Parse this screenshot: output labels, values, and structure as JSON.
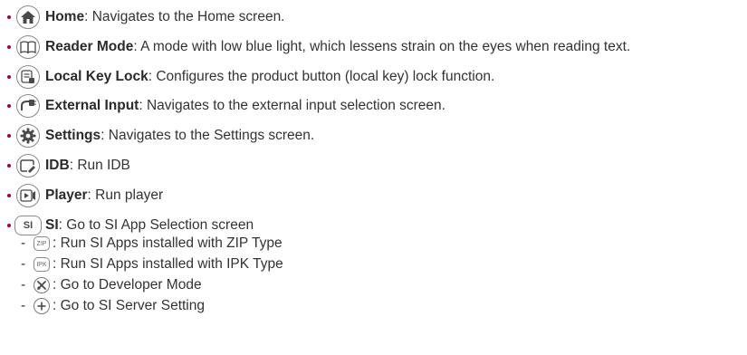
{
  "items": [
    {
      "label": "Home",
      "desc": ": Navigates to the Home screen.",
      "icon": "home-icon"
    },
    {
      "label": "Reader Mode",
      "desc": ": A mode with low blue light, which lessens strain on the eyes when reading text.",
      "icon": "book-icon"
    },
    {
      "label": "Local Key Lock",
      "desc": ": Configures the product button (local key) lock function.",
      "icon": "key-lock-icon"
    },
    {
      "label": "External Input",
      "desc": ": Navigates to the external input selection screen.",
      "icon": "input-plug-icon"
    },
    {
      "label": "Settings",
      "desc": ": Navigates to the Settings screen.",
      "icon": "gear-icon"
    },
    {
      "label": "IDB",
      "desc": ": Run IDB",
      "icon": "idb-icon"
    },
    {
      "label": "Player",
      "desc": ": Run player",
      "icon": "player-icon"
    },
    {
      "label": "SI",
      "desc": ": Go to SI App Selection screen",
      "icon": "si-icon",
      "icon_text": "SI"
    }
  ],
  "sub_items": [
    {
      "dash": "-",
      "icon": "zip-icon",
      "icon_text": "ZIP",
      "desc": ": Run SI Apps installed with ZIP Type"
    },
    {
      "dash": "-",
      "icon": "ipk-icon",
      "icon_text": "IPK",
      "desc": ": Run SI Apps installed with IPK Type"
    },
    {
      "dash": "-",
      "icon": "developer-mode-icon",
      "desc": ": Go to Developer Mode"
    },
    {
      "dash": "-",
      "icon": "plus-icon",
      "desc": ": Go to SI Server Setting"
    }
  ],
  "colors": {
    "bullet": "#a50034",
    "icon_stroke": "#8a8a8a",
    "text": "#333333"
  }
}
